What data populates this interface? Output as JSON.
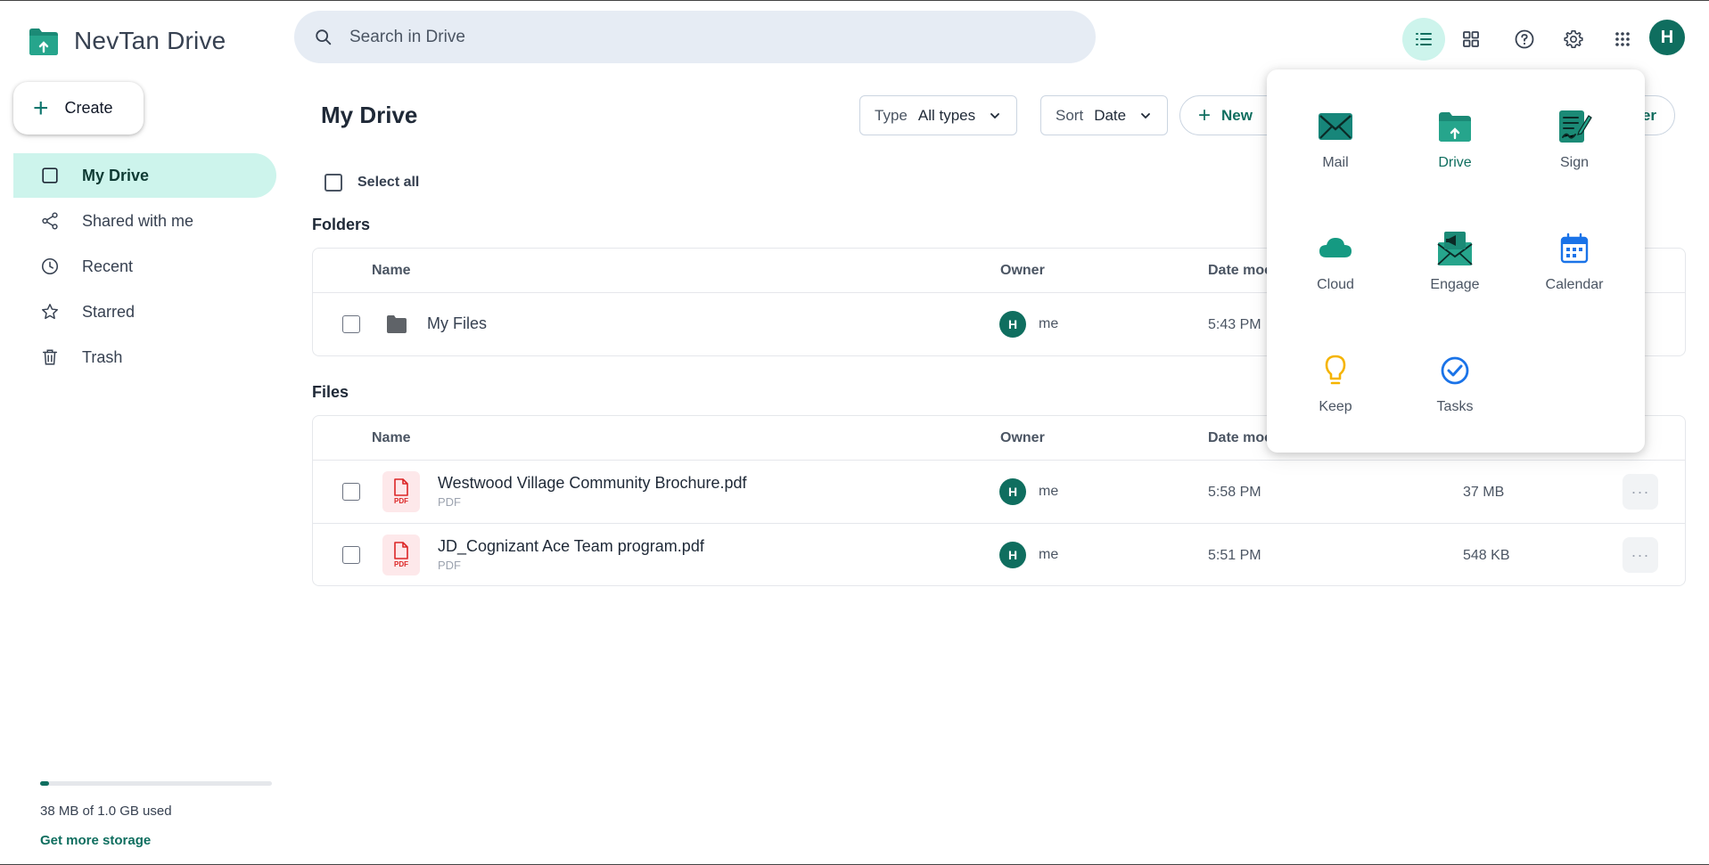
{
  "app": {
    "name": "NevTan Drive"
  },
  "search": {
    "placeholder": "Search in Drive"
  },
  "header": {
    "avatar_initial": "H",
    "icons": [
      "list-view-icon",
      "grid-view-icon",
      "help-icon",
      "settings-icon",
      "apps-grid-icon"
    ]
  },
  "sidebar": {
    "create_label": "Create",
    "items": [
      {
        "label": "My Drive",
        "icon": "drive-icon",
        "active": true
      },
      {
        "label": "Shared with me",
        "icon": "share-icon",
        "active": false
      },
      {
        "label": "Recent",
        "icon": "clock-icon",
        "active": false
      },
      {
        "label": "Starred",
        "icon": "star-icon",
        "active": false
      },
      {
        "label": "Trash",
        "icon": "trash-icon",
        "active": false
      }
    ],
    "storage": {
      "used_fraction": 0.037,
      "text": "38 MB of 1.0 GB used",
      "link": "Get more storage"
    }
  },
  "main": {
    "title": "My Drive",
    "type_filter": {
      "key": "Type",
      "value": "All types"
    },
    "sort_filter": {
      "key": "Sort",
      "value": "Date"
    },
    "new_button": "New",
    "hidden_button_tail": "er",
    "select_all": "Select all",
    "folders": {
      "label": "Folders",
      "columns": {
        "name": "Name",
        "owner": "Owner",
        "date": "Date moc"
      },
      "rows": [
        {
          "name": "My Files",
          "owner_initial": "H",
          "owner": "me",
          "date": "5:43 PM"
        }
      ]
    },
    "files": {
      "label": "Files",
      "columns": {
        "name": "Name",
        "owner": "Owner",
        "date": "Date moc"
      },
      "rows": [
        {
          "name": "Westwood Village Community Brochure.pdf",
          "type": "PDF",
          "owner_initial": "H",
          "owner": "me",
          "date": "5:58 PM",
          "size": "37 MB"
        },
        {
          "name": "JD_Cognizant Ace Team program.pdf",
          "type": "PDF",
          "owner_initial": "H",
          "owner": "me",
          "date": "5:51 PM",
          "size": "548 KB"
        }
      ]
    },
    "pdf_tile_text": "PDF",
    "more_glyph": "···"
  },
  "apps_popup": {
    "apps": [
      {
        "label": "Mail",
        "icon": "mail-icon",
        "active": false
      },
      {
        "label": "Drive",
        "icon": "drive-icon",
        "active": true
      },
      {
        "label": "Sign",
        "icon": "sign-icon",
        "active": false
      },
      {
        "label": "Cloud",
        "icon": "cloud-icon",
        "active": false
      },
      {
        "label": "Engage",
        "icon": "engage-icon",
        "active": false
      },
      {
        "label": "Calendar",
        "icon": "calendar-icon",
        "active": false
      },
      {
        "label": "Keep",
        "icon": "bulb-icon",
        "active": false
      },
      {
        "label": "Tasks",
        "icon": "check-circle-icon",
        "active": false
      }
    ]
  },
  "colors": {
    "brand": "#0f6e5f",
    "active_bg": "#cdf4ec",
    "search_bg": "#e6ecf4",
    "pdf_red": "#dc2626",
    "calendar_blue": "#1a73e8",
    "keep_yellow": "#f5b400"
  }
}
